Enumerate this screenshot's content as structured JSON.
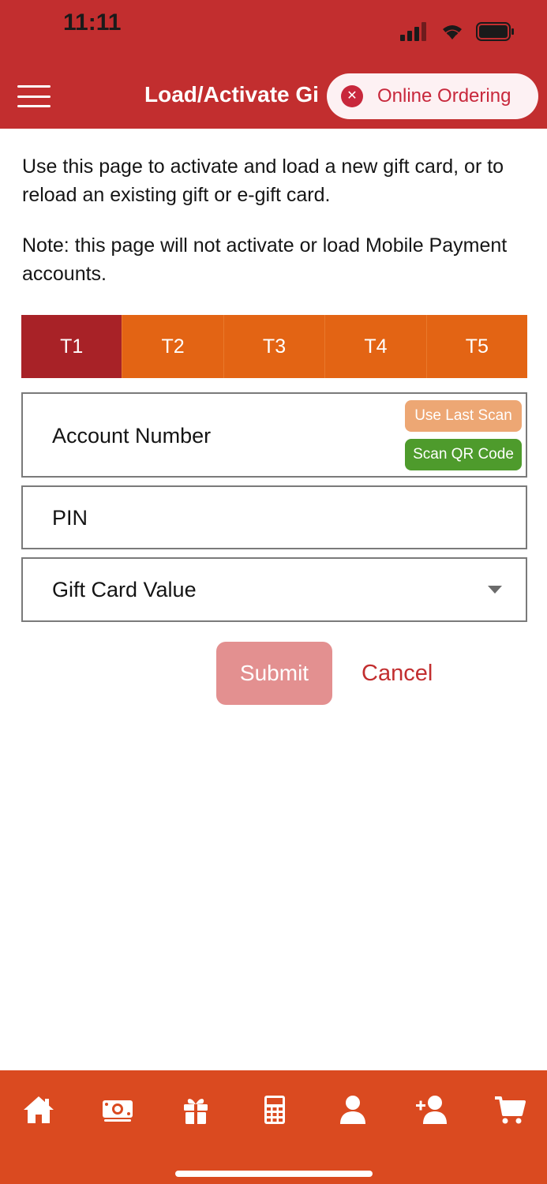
{
  "status_bar": {
    "time": "11:11"
  },
  "header": {
    "title": "Load/Activate Gi",
    "online_ordering_label": "Online Ordering"
  },
  "intro_text": "Use this page to activate and load a new gift card, or to reload an existing gift or e-gift card.",
  "note_text": "Note: this page will not activate or load Mobile Payment accounts.",
  "tabs": [
    {
      "label": "T1",
      "active": true
    },
    {
      "label": "T2"
    },
    {
      "label": "T3"
    },
    {
      "label": "T4"
    },
    {
      "label": "T5"
    }
  ],
  "form": {
    "account_number_label": "Account Number",
    "use_last_scan_label": "Use Last Scan",
    "scan_qr_label": "Scan QR Code",
    "pin_label": "PIN",
    "gift_card_value_label": "Gift Card Value",
    "submit_label": "Submit",
    "cancel_label": "Cancel"
  },
  "bottom_nav": [
    {
      "icon": "home-icon"
    },
    {
      "icon": "money-icon"
    },
    {
      "icon": "gift-icon"
    },
    {
      "icon": "calculator-icon"
    },
    {
      "icon": "user-icon"
    },
    {
      "icon": "add-user-icon"
    },
    {
      "icon": "cart-icon"
    }
  ],
  "colors": {
    "header_red": "#c22e2f",
    "tab_orange": "#e36414",
    "tab_active": "#a82227",
    "nav_orange": "#da4a20",
    "scan_green": "#4e9b2c",
    "last_scan_peach": "#eda774",
    "submit_disabled": "#e39090"
  }
}
